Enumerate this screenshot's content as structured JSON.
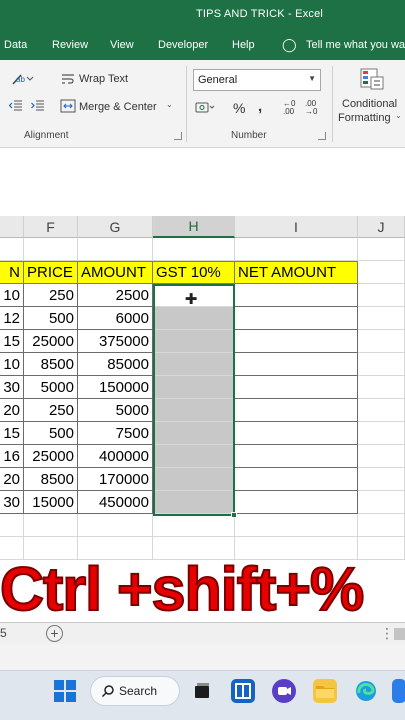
{
  "window": {
    "title": "TIPS AND TRICK  -  Excel"
  },
  "ribbon_tabs": [
    "Data",
    "Review",
    "View",
    "Developer",
    "Help",
    "Tell me what you wa"
  ],
  "ribbon": {
    "wrap_text": "Wrap Text",
    "merge_center": "Merge & Center",
    "alignment_group": "Alignment",
    "number_format": "General",
    "percent": "%",
    "comma": ",",
    "inc_decimal": "←0 .00",
    "dec_decimal": ".00 →0",
    "number_group": "Number",
    "conditional_formatting_1": "Conditional",
    "conditional_formatting_2": "Formatting"
  },
  "columns": [
    "",
    "F",
    "G",
    "H",
    "I",
    "J"
  ],
  "selected_column": "H",
  "headers": [
    "N",
    "PRICE",
    "AMOUNT",
    "GST 10%",
    "NET AMOUNT"
  ],
  "rows": [
    {
      "qty": "10",
      "price": "250",
      "amount": "2500"
    },
    {
      "qty": "12",
      "price": "500",
      "amount": "6000"
    },
    {
      "qty": "15",
      "price": "25000",
      "amount": "375000"
    },
    {
      "qty": "10",
      "price": "8500",
      "amount": "85000"
    },
    {
      "qty": "30",
      "price": "5000",
      "amount": "150000"
    },
    {
      "qty": "20",
      "price": "250",
      "amount": "5000"
    },
    {
      "qty": "15",
      "price": "500",
      "amount": "7500"
    },
    {
      "qty": "16",
      "price": "25000",
      "amount": "400000"
    },
    {
      "qty": "20",
      "price": "8500",
      "amount": "170000"
    },
    {
      "qty": "30",
      "price": "15000",
      "amount": "450000"
    }
  ],
  "caption": "Ctrl +shift+%",
  "sheetbar": {
    "page": "5",
    "add": "+"
  },
  "taskbar": {
    "search": "Search"
  },
  "colors": {
    "excel_green": "#1e7145",
    "header_yellow": "#ffff00",
    "caption_red": "#e60000"
  }
}
